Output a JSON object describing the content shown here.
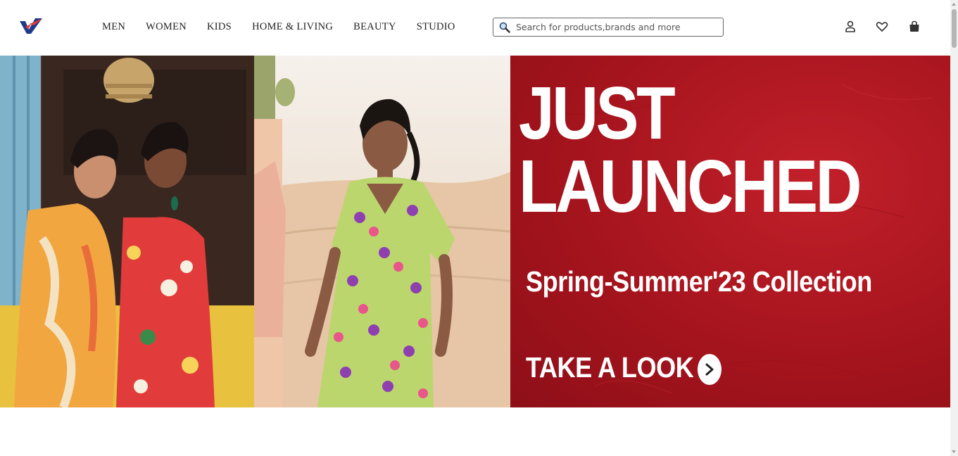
{
  "header": {
    "nav": [
      "MEN",
      "WOMEN",
      "KIDS",
      "HOME & LIVING",
      "BEAUTY",
      "STUDIO"
    ],
    "search": {
      "placeholder": "Search for products,brands and more"
    },
    "icons": [
      "profile-icon",
      "wishlist-heart-icon",
      "shopping-bag-icon"
    ],
    "logo_colors": {
      "primary": "#1f3a8a",
      "accent": "#e23b3b"
    }
  },
  "banner": {
    "headline_line1": "JUST",
    "headline_line2": "LAUNCHED",
    "subheading": "Spring-Summer'23 Collection",
    "cta_label": "TAKE A LOOK",
    "accent_color": "#b01a22"
  }
}
